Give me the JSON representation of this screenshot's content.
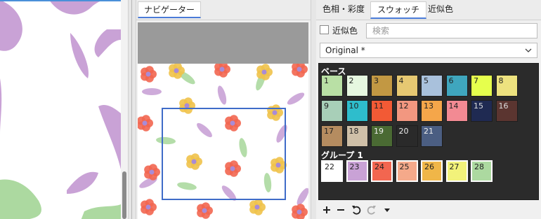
{
  "navigator": {
    "tab_label": "ナビゲーター"
  },
  "color_panel": {
    "tabs": [
      {
        "label": "色相・彩度",
        "active": false
      },
      {
        "label": "スウォッチ",
        "active": true
      },
      {
        "label": "近似色",
        "active": false
      }
    ],
    "approx_checkbox_label": "近似色",
    "search_placeholder": "検索",
    "palette_select_value": "Original *",
    "sections": [
      {
        "title": "ベース"
      },
      {
        "title": "グループ 1"
      }
    ],
    "swatches": [
      {
        "num": "1",
        "color": "#b9e0a5",
        "text": "#222"
      },
      {
        "num": "2",
        "color": "#e6f7e0",
        "text": "#222"
      },
      {
        "num": "3",
        "color": "#c29843",
        "text": "#222"
      },
      {
        "num": "4",
        "color": "#e6c872",
        "text": "#222"
      },
      {
        "num": "5",
        "color": "#a9c1dc",
        "text": "#222"
      },
      {
        "num": "6",
        "color": "#3fa6be",
        "text": "#222"
      },
      {
        "num": "7",
        "color": "#e6ff4d",
        "text": "#222"
      },
      {
        "num": "8",
        "color": "#ede27f",
        "text": "#222"
      },
      {
        "num": "9",
        "color": "#a8cfb8",
        "text": "#222"
      },
      {
        "num": "10",
        "color": "#2ebdcc",
        "text": "#222"
      },
      {
        "num": "11",
        "color": "#f25a35",
        "text": "#222"
      },
      {
        "num": "12",
        "color": "#f29780",
        "text": "#222"
      },
      {
        "num": "13",
        "color": "#f5a64a",
        "text": "#222"
      },
      {
        "num": "14",
        "color": "#f28a93",
        "text": "#222"
      },
      {
        "num": "15",
        "color": "#1f2a52",
        "text": "#dddddd"
      },
      {
        "num": "16",
        "color": "#5b3530",
        "text": "#dddddd"
      },
      {
        "num": "17",
        "color": "#b58c60",
        "text": "#222"
      },
      {
        "num": "18",
        "color": "#cfc0a8",
        "text": "#222"
      },
      {
        "num": "19",
        "color": "#4a6a33",
        "text": "#eeeeee"
      },
      {
        "num": "20",
        "color": "#2a2a2a",
        "text": "#eeeeee"
      },
      {
        "num": "21",
        "color": "#4b5e82",
        "text": "#eeeeee"
      }
    ],
    "group1_swatches": [
      {
        "num": "22",
        "color": "#ffffff",
        "text": "#222"
      },
      {
        "num": "23",
        "color": "#c9a2d6",
        "text": "#222"
      },
      {
        "num": "24",
        "color": "#f26650",
        "text": "#222"
      },
      {
        "num": "25",
        "color": "#f5a98a",
        "text": "#222"
      },
      {
        "num": "26",
        "color": "#f0b648",
        "text": "#222"
      },
      {
        "num": "27",
        "color": "#f2f27a",
        "text": "#222"
      },
      {
        "num": "28",
        "color": "#acd9a0",
        "text": "#222"
      }
    ],
    "toolbar_icons": [
      "plus-icon",
      "minus-icon",
      "undo-icon",
      "redo-icon",
      "caret-down-icon"
    ]
  }
}
